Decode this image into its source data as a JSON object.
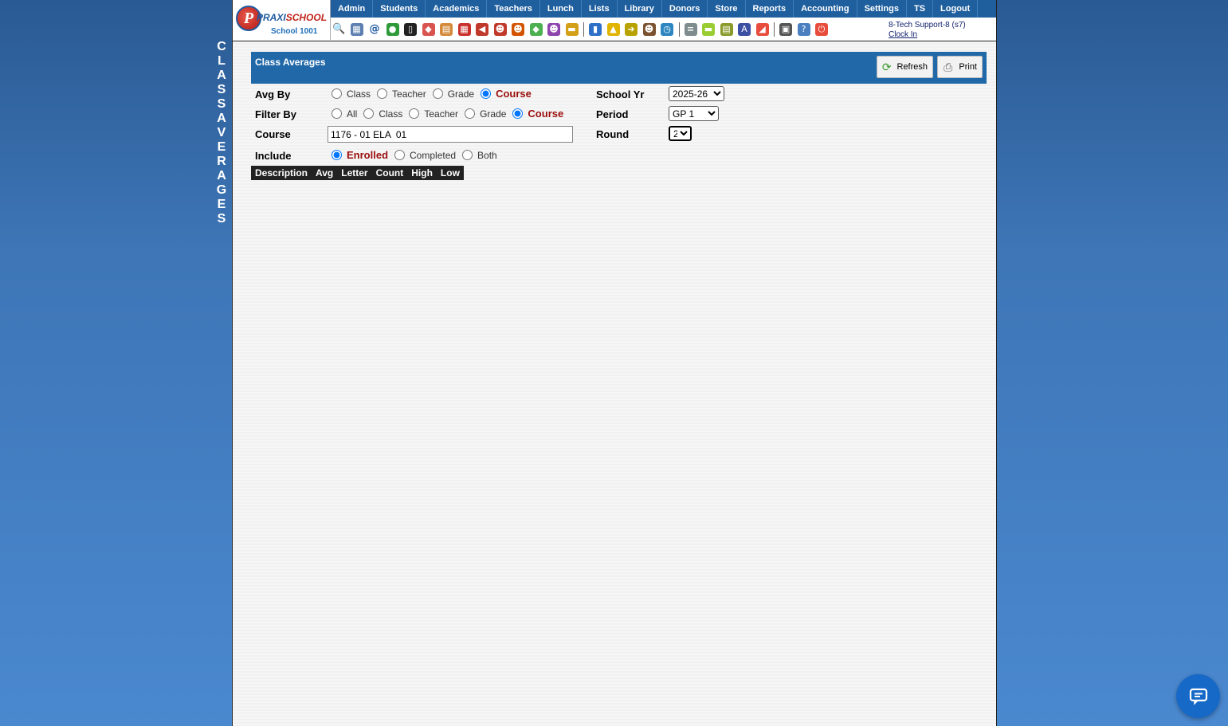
{
  "side_title": "CLASS AVERAGES",
  "logo": {
    "letter": "P",
    "brand_part1": "PRAXI",
    "brand_part2": "SCHOOL",
    "school_name": "School 1001"
  },
  "menu": [
    "Admin",
    "Students",
    "Academics",
    "Teachers",
    "Lunch",
    "Lists",
    "Library",
    "Donors",
    "Store",
    "Reports",
    "Accounting",
    "Settings",
    "TS",
    "Logout"
  ],
  "toolbar_icons": [
    {
      "name": "search-icon",
      "glyph": "🔍",
      "bg": "transparent"
    },
    {
      "name": "grid-icon",
      "glyph": "▦",
      "bg": "#5a7fb0"
    },
    {
      "name": "email-at-icon",
      "glyph": "@",
      "bg": "transparent"
    },
    {
      "name": "chat-bubbles-icon",
      "glyph": "●",
      "bg": "#2e9a3a"
    },
    {
      "name": "mobile-phone-icon",
      "glyph": "▯",
      "bg": "#222"
    },
    {
      "name": "flag-icon",
      "glyph": "◆",
      "bg": "#d9534f"
    },
    {
      "name": "form-icon",
      "glyph": "▤",
      "bg": "#d48a3a"
    },
    {
      "name": "calendar-icon",
      "glyph": "▦",
      "bg": "#c9302c"
    },
    {
      "name": "megaphone-icon",
      "glyph": "◀",
      "bg": "#c0392b"
    },
    {
      "name": "student-icon",
      "glyph": "☻",
      "bg": "#c0392b"
    },
    {
      "name": "teacher-icon",
      "glyph": "☻",
      "bg": "#d35400"
    },
    {
      "name": "money-icon",
      "glyph": "◆",
      "bg": "#4caf50"
    },
    {
      "name": "group-icon",
      "glyph": "☻",
      "bg": "#8e44ad"
    },
    {
      "name": "lunch-burger-icon",
      "glyph": "▬",
      "bg": "#d4a017"
    },
    {
      "name": "book-icon",
      "glyph": "▮",
      "bg": "#2e6fc7"
    },
    {
      "name": "bell-icon",
      "glyph": "▲",
      "bg": "#e0b400"
    },
    {
      "name": "arrow-icon",
      "glyph": "➜",
      "bg": "#b8a200"
    },
    {
      "name": "people-icon",
      "glyph": "☻",
      "bg": "#7a5230"
    },
    {
      "name": "clock-icon",
      "glyph": "◷",
      "bg": "#2e86c1"
    },
    {
      "name": "list-icon",
      "glyph": "≡",
      "bg": "#7f8c8d"
    },
    {
      "name": "card-icon",
      "glyph": "▬",
      "bg": "#9acd32"
    },
    {
      "name": "printer-icon",
      "glyph": "▤",
      "bg": "#8a9a2a"
    },
    {
      "name": "ap-icon",
      "glyph": "A",
      "bg": "#3b4fa3"
    },
    {
      "name": "pdf-icon",
      "glyph": "◢",
      "bg": "#e74c3c"
    },
    {
      "name": "cash-register-icon",
      "glyph": "▣",
      "bg": "#555"
    },
    {
      "name": "help-icon",
      "glyph": "?",
      "bg": "#4a7fc0"
    },
    {
      "name": "power-icon",
      "glyph": "⏻",
      "bg": "#e74c3c"
    }
  ],
  "user": {
    "name": "8-Tech Support-8 (s7)",
    "clock_in": "Clock In"
  },
  "panel": {
    "title": "Class Averages",
    "refresh_label": "Refresh",
    "print_label": "Print"
  },
  "form": {
    "avg_by": {
      "label": "Avg By",
      "options": [
        "Class",
        "Teacher",
        "Grade",
        "Course"
      ],
      "selected": "Course"
    },
    "filter_by": {
      "label": "Filter By",
      "options": [
        "All",
        "Class",
        "Teacher",
        "Grade",
        "Course"
      ],
      "selected": "Course"
    },
    "course": {
      "label": "Course",
      "value": "1176 - 01 ELA  01"
    },
    "include": {
      "label": "Include",
      "options": [
        "Enrolled",
        "Completed",
        "Both"
      ],
      "selected": "Enrolled"
    },
    "school_yr": {
      "label": "School Yr",
      "value": "2025-26"
    },
    "period": {
      "label": "Period",
      "value": "GP 1"
    },
    "round": {
      "label": "Round",
      "value": "2"
    }
  },
  "table": {
    "columns": [
      "Description",
      "Avg",
      "Letter",
      "Count",
      "High",
      "Low"
    ],
    "rows": []
  },
  "colors": {
    "menu_bg": "#1f5f9e",
    "title_bar": "#2068a8",
    "selected_text": "#9b0d0d",
    "header_row": "#222222",
    "chat_button": "#1769c7"
  }
}
